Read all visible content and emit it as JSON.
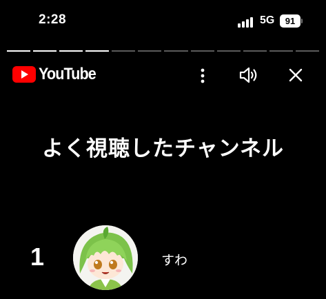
{
  "status_bar": {
    "time": "2:28",
    "network": "5G",
    "battery": "91"
  },
  "story_progress": {
    "total_segments": 12,
    "completed_segments": 4
  },
  "header": {
    "brand": "YouTube",
    "icons": [
      "more-vert-icon",
      "speaker-icon",
      "close-icon"
    ],
    "brand_color": "#ff0000"
  },
  "title": "よく視聴したチャンネル",
  "ranking": [
    {
      "rank": "1",
      "channel_name": "すわ",
      "avatar": "anime-character-avatar"
    }
  ]
}
